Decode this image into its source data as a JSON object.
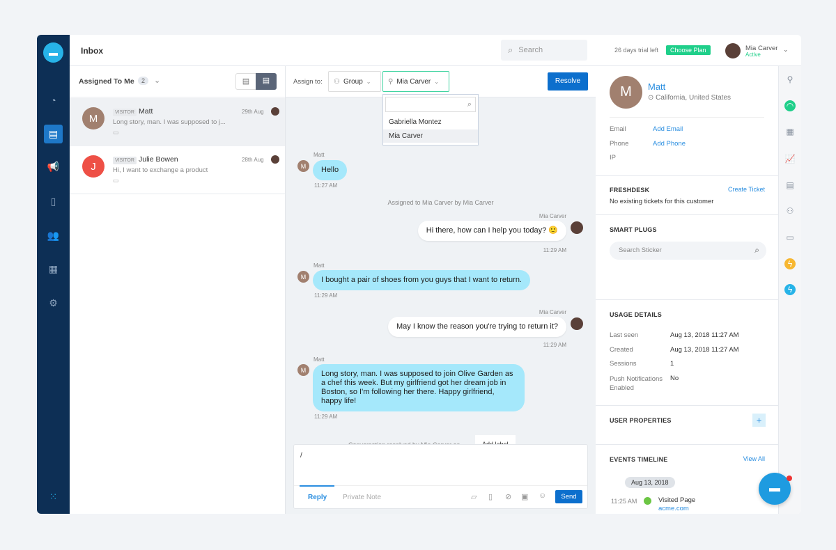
{
  "header": {
    "title": "Inbox",
    "search_placeholder": "Search",
    "trial": "26 days trial left",
    "choose_plan": "Choose Plan",
    "user_name": "Mia Carver",
    "user_status": "Active"
  },
  "list": {
    "filter": "Assigned To Me",
    "count": "2",
    "items": [
      {
        "initial": "M",
        "badge": "VISITOR",
        "name": "Matt",
        "date": "29th Aug",
        "preview": "Long story, man. I was supposed to j...",
        "color": "#a1806f"
      },
      {
        "initial": "J",
        "badge": "VISITOR",
        "name": "Julie Bowen",
        "date": "28th Aug",
        "preview": "Hi, I want to exchange a product",
        "color": "#ee5046"
      }
    ]
  },
  "assign": {
    "label": "Assign to:",
    "group": "Group",
    "agent": "Mia Carver",
    "resolve": "Resolve",
    "options": [
      "Gabriella Montez",
      "Mia Carver"
    ]
  },
  "messages": [
    {
      "sender": "Matt",
      "text": "Hello",
      "time": "11:27 AM"
    },
    {
      "system": "Assigned to Mia Carver by Mia Carver"
    },
    {
      "sender": "Mia Carver",
      "text": "Hi there, how can I help you today? 🙂",
      "time": "11:29 AM"
    },
    {
      "sender": "Matt",
      "text": "I bought a pair of shoes from you guys that I want to return.",
      "time": "11:29 AM"
    },
    {
      "sender": "Mia Carver",
      "text": "May I know the reason you're trying to return it?",
      "time": "11:29 AM"
    },
    {
      "sender": "Matt",
      "text": "Long story, man. I was supposed to join Olive Garden as a chef this week. But my girlfriend got her dream job in Boston, so I'm following her there. Happy girlfriend, happy life!",
      "time": "11:29 AM"
    },
    {
      "system": "Conversation resolved by Mia Carver as",
      "label": "Add label"
    }
  ],
  "composer": {
    "value": "/",
    "reply": "Reply",
    "private_note": "Private Note",
    "send": "Send"
  },
  "profile": {
    "initial": "M",
    "name": "Matt",
    "location": "California, United States",
    "email_label": "Email",
    "email_action": "Add Email",
    "phone_label": "Phone",
    "phone_action": "Add Phone",
    "ip_label": "IP"
  },
  "freshdesk": {
    "title": "FRESHDESK",
    "action": "Create Ticket",
    "text": "No existing tickets for this customer"
  },
  "smart_plugs": {
    "title": "SMART PLUGS",
    "placeholder": "Search Sticker"
  },
  "usage": {
    "title": "USAGE DETAILS",
    "rows": [
      {
        "label": "Last seen",
        "value": "Aug 13, 2018 11:27 AM"
      },
      {
        "label": "Created",
        "value": "Aug 13, 2018 11:27 AM"
      },
      {
        "label": "Sessions",
        "value": "1"
      },
      {
        "label": "Push Notifications Enabled",
        "value": "No"
      }
    ]
  },
  "user_properties": {
    "title": "USER PROPERTIES",
    "add": "+"
  },
  "events": {
    "title": "EVENTS TIMELINE",
    "action": "View All",
    "date": "Aug 13, 2018",
    "time": "11:25 AM",
    "event": "Visited Page",
    "url": "acme.com"
  },
  "colors": {
    "sidebar": "#0d2f55",
    "accent": "#1e78c8",
    "green": "#1fcf8a",
    "bubble": "#a5e8fb"
  }
}
